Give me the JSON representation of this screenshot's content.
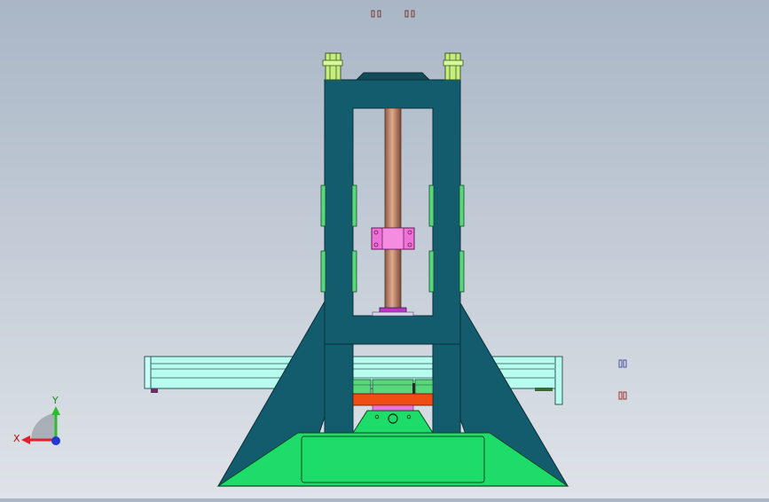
{
  "viewport": {
    "background_top": "#a9b6c6",
    "background_bottom": "#dfe3e8"
  },
  "triad": {
    "x_label": "X",
    "y_label": "Y",
    "x_color": "#e0202a",
    "y_color": "#28c028",
    "z_color": "#2038d8"
  },
  "model": {
    "frame_color": "#135c6e",
    "frame_edge": "#0a2f38",
    "base_color": "#1ddc6a",
    "rail_color": "#b8fbef",
    "clamp_color": "#c6ee7e",
    "bracket_color": "#58d87a",
    "leadscrew_color": "#c98a6a",
    "nut_color": "#ef72d8",
    "collar_color": "#b838c8",
    "plate_color": "#f04d14"
  }
}
